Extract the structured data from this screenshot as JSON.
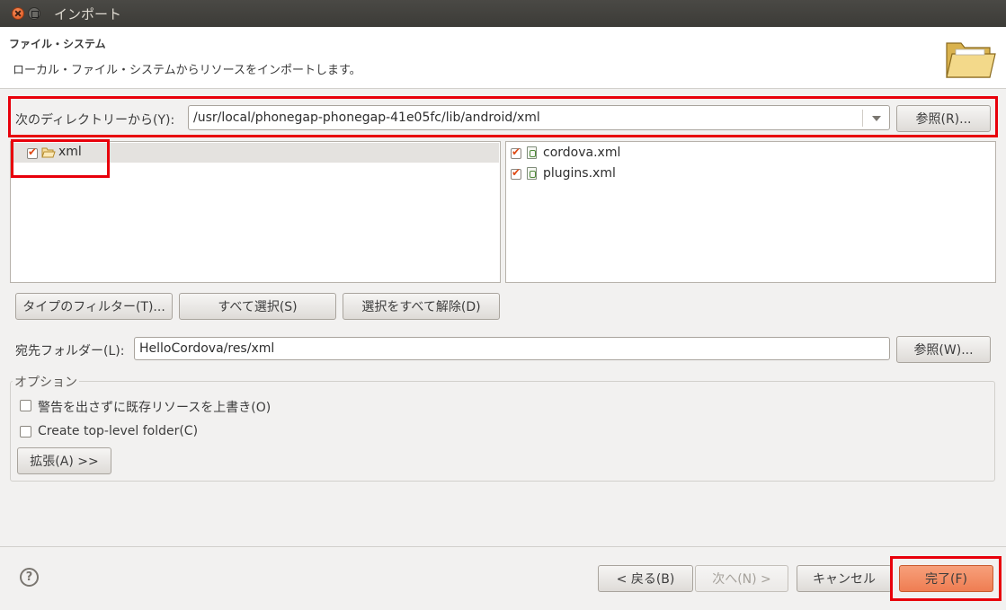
{
  "window": {
    "title": "インポート"
  },
  "header": {
    "title": "ファイル・システム",
    "description": "ローカル・ファイル・システムからリソースをインポートします。"
  },
  "directory": {
    "label": "次のディレクトリーから(Y):",
    "value": "/usr/local/phonegap-phonegap-41e05fc/lib/android/xml",
    "browse_label": "参照(R)..."
  },
  "folders": [
    {
      "name": "xml",
      "checked": true
    }
  ],
  "files": [
    {
      "name": "cordova.xml",
      "checked": true
    },
    {
      "name": "plugins.xml",
      "checked": true
    }
  ],
  "filter_buttons": {
    "filter_types": "タイプのフィルター(T)...",
    "select_all": "すべて選択(S)",
    "deselect_all": "選択をすべて解除(D)"
  },
  "destination": {
    "label": "宛先フォルダー(L):",
    "value": "HelloCordova/res/xml",
    "browse_label": "参照(W)..."
  },
  "options": {
    "title": "オプション",
    "overwrite": {
      "label": "警告を出さずに既存リソースを上書き(O)",
      "checked": false
    },
    "top_level_folder": {
      "label": "Create top-level folder(C)",
      "checked": false
    },
    "advanced_label": "拡張(A) >>"
  },
  "footer": {
    "back_label": "< 戻る(B)",
    "next_label": "次へ(N) >",
    "cancel_label": "キャンセル",
    "finish_label": "完了(F)"
  },
  "colors": {
    "highlight": "#e8000b",
    "primary_button": "#ef7d52",
    "check_mark": "#df4a16"
  }
}
